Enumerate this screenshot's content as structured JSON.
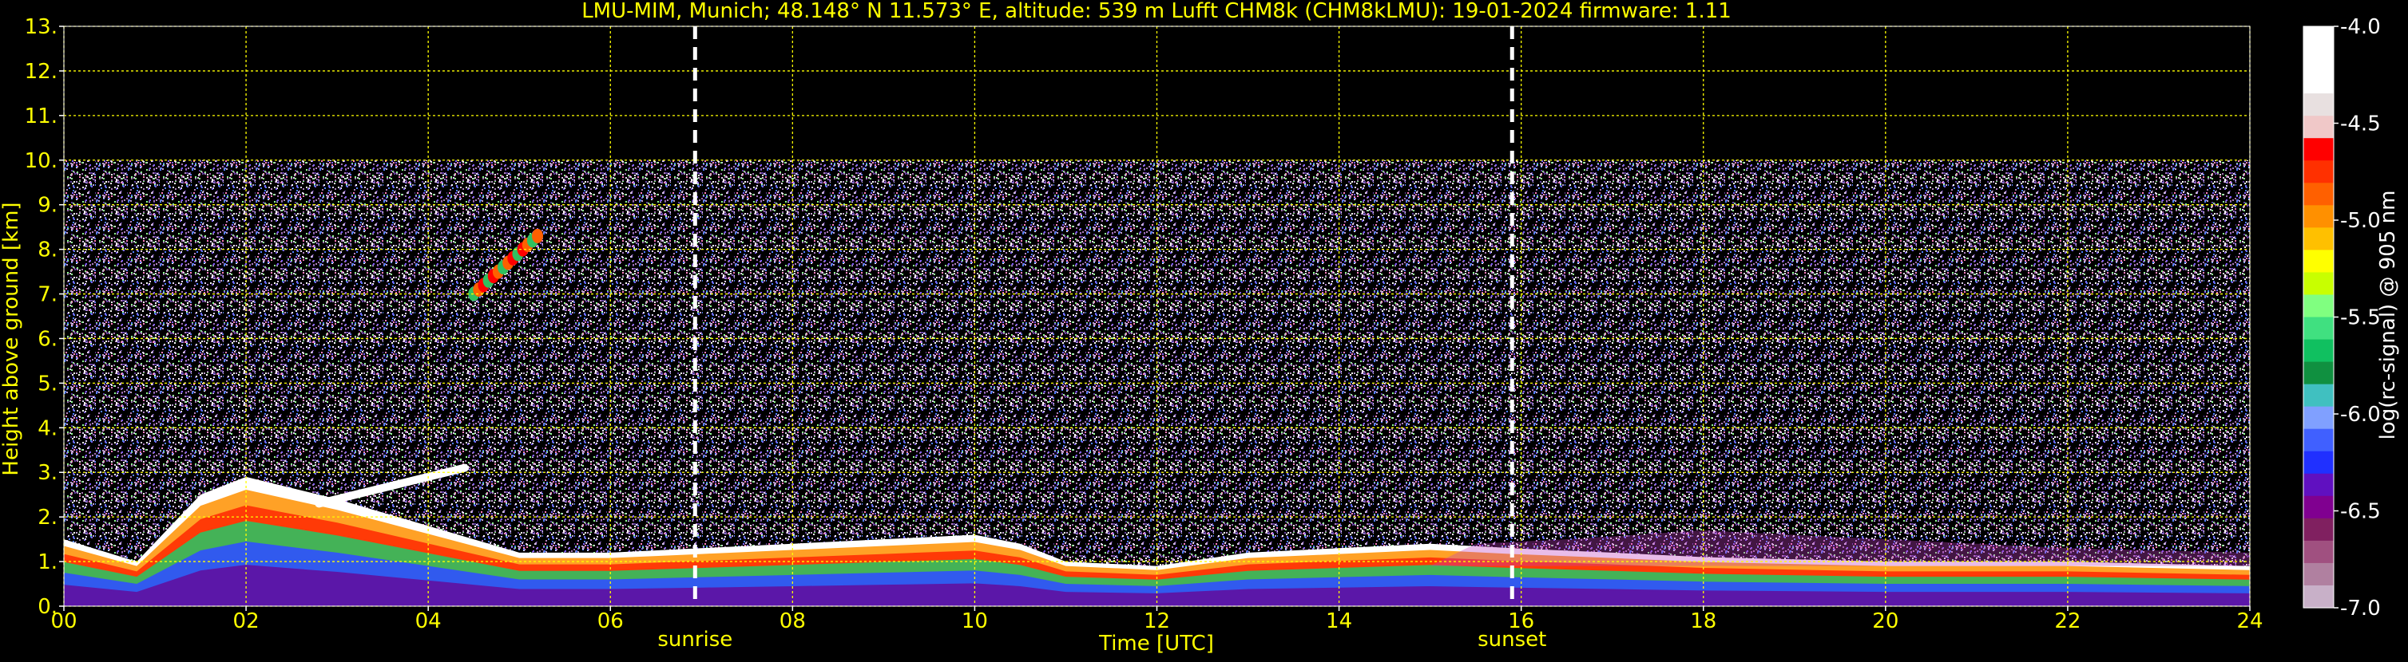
{
  "chart_data": {
    "type": "heatmap",
    "title": "LMU-MIM, Munich; 48.148° N 11.573° E, altitude: 539 m    Lufft CHM8k (CHM8kLMU): 19-01-2024    firmware: 1.11",
    "xlabel": "Time [UTC]",
    "ylabel": "Height above ground [km]",
    "xlim": [
      0,
      24
    ],
    "ylim": [
      0,
      13
    ],
    "x_ticks": [
      0,
      2,
      4,
      6,
      8,
      10,
      12,
      14,
      16,
      18,
      20,
      22,
      24
    ],
    "x_tick_labels": [
      "00",
      "02",
      "04",
      "06",
      "08",
      "10",
      "12",
      "14",
      "16",
      "18",
      "20",
      "22",
      "24"
    ],
    "y_ticks": [
      0,
      1,
      2,
      3,
      4,
      5,
      6,
      7,
      8,
      9,
      10,
      11,
      12,
      13
    ],
    "y_tick_labels": [
      "0.",
      "1.",
      "2.",
      "3.",
      "4.",
      "5.",
      "6.",
      "7.",
      "8.",
      "9.",
      "10.",
      "11.",
      "12.",
      "13."
    ],
    "grid": true,
    "grid_color": "#ffff00",
    "text_color": "#ffff00",
    "background": "#000000",
    "data_ceiling_km": 10,
    "markers": [
      {
        "label": "sunrise",
        "x": 6.93
      },
      {
        "label": "sunset",
        "x": 15.9
      }
    ],
    "colorbar": {
      "label": "log(rc-signal) @ 905 nm",
      "range": [
        -7.0,
        -4.0
      ],
      "ticks": [
        -4.0,
        -4.5,
        -5.0,
        -5.5,
        -6.0,
        -6.5,
        -7.0
      ],
      "tick_labels": [
        "-4.0",
        "-4.5",
        "-5.0",
        "-5.5",
        "-6.0",
        "-6.5",
        "-7.0"
      ],
      "colors": [
        "#ffffff",
        "#ffffff",
        "#ffffff",
        "#e8e0e0",
        "#f0c8c8",
        "#ff0000",
        "#ff3000",
        "#ff6000",
        "#ff9000",
        "#ffc000",
        "#ffff00",
        "#c8ff00",
        "#80ff80",
        "#40e080",
        "#10c060",
        "#109040",
        "#40c0c0",
        "#80a0ff",
        "#4060ff",
        "#2030ff",
        "#6010c0",
        "#800090",
        "#802060",
        "#a05080",
        "#b080a0",
        "#c8b0c8"
      ]
    },
    "features": [
      {
        "kind": "boundary-layer",
        "x": [
          0,
          0.8,
          1.5,
          2,
          3,
          4,
          5,
          6,
          7,
          8,
          9,
          10,
          10.5,
          11,
          12,
          13,
          14,
          15,
          15.9,
          17,
          18,
          20,
          22,
          24
        ],
        "top_km": [
          1.5,
          1.0,
          2.5,
          2.9,
          2.4,
          1.8,
          1.2,
          1.2,
          1.3,
          1.4,
          1.5,
          1.6,
          1.4,
          1.0,
          0.9,
          1.2,
          1.3,
          1.4,
          1.3,
          1.2,
          1.1,
          1.0,
          1.0,
          0.9
        ]
      },
      {
        "kind": "cirrus",
        "x": [
          4.5,
          5.2
        ],
        "y_km": [
          7.0,
          8.3
        ]
      },
      {
        "kind": "cloud-layer",
        "x": [
          2.8,
          4.4
        ],
        "y_km": [
          2.3,
          3.1
        ]
      }
    ]
  }
}
